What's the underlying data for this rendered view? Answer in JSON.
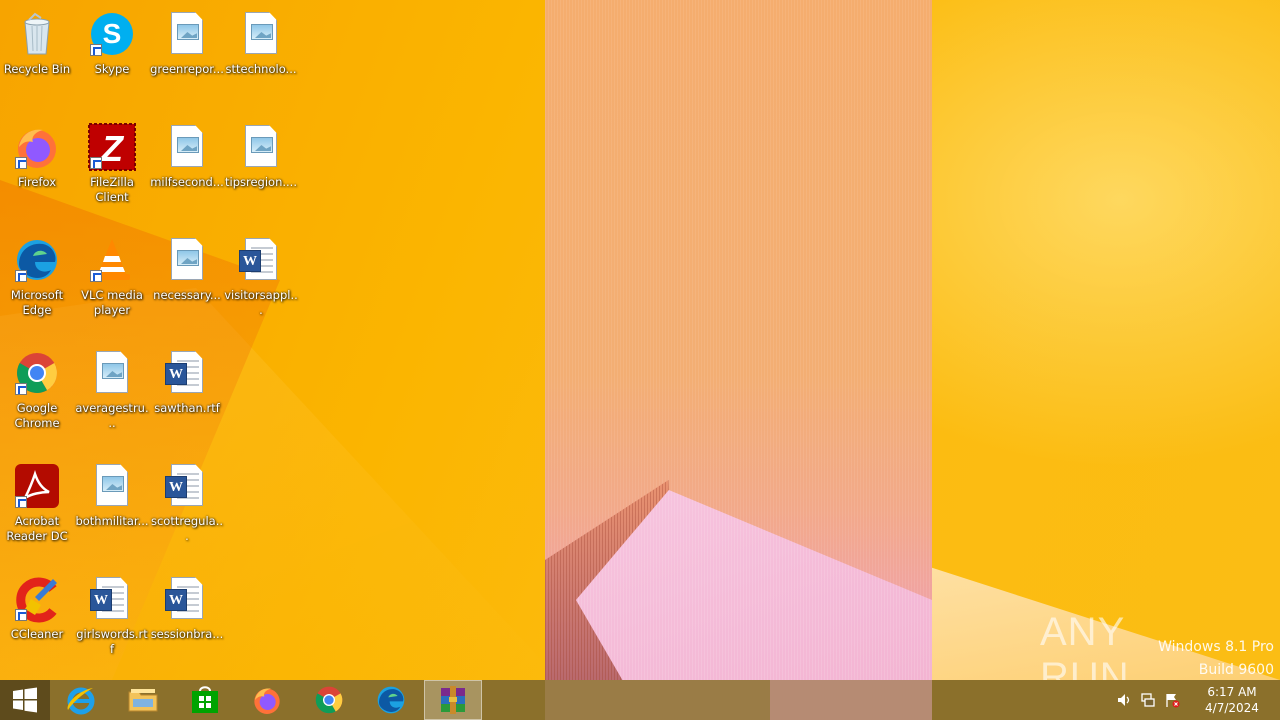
{
  "desktop": {
    "icons": [
      {
        "label": "Recycle Bin"
      },
      {
        "label": "Skype"
      },
      {
        "label": "greenrepor..."
      },
      {
        "label": "sttechnolo..."
      },
      {
        "label": "Firefox"
      },
      {
        "label": "FileZilla Client"
      },
      {
        "label": "milfsecond..."
      },
      {
        "label": "tipsregion...."
      },
      {
        "label": "Microsoft Edge"
      },
      {
        "label": "VLC media player"
      },
      {
        "label": "necessary..."
      },
      {
        "label": "visitorsappl..."
      },
      {
        "label": "Google Chrome"
      },
      {
        "label": "averagestru..."
      },
      {
        "label": "sawthan.rtf"
      },
      {
        "label": "Acrobat Reader DC"
      },
      {
        "label": "bothmilitar..."
      },
      {
        "label": "scottregula..."
      },
      {
        "label": "CCleaner"
      },
      {
        "label": "girlswords.rtf"
      },
      {
        "label": "sessionbra..."
      }
    ]
  },
  "watermark": {
    "text": "ANY RUN"
  },
  "windows_info": {
    "edition": "Windows 8.1 Pro",
    "build": "Build 9600"
  },
  "taskbar": {
    "clock": {
      "time": "6:17 AM",
      "date": "4/7/2024"
    }
  },
  "colors": {
    "wallpaper": "#fbb500",
    "taskbar": "#786432",
    "word_blue": "#2a5699"
  }
}
